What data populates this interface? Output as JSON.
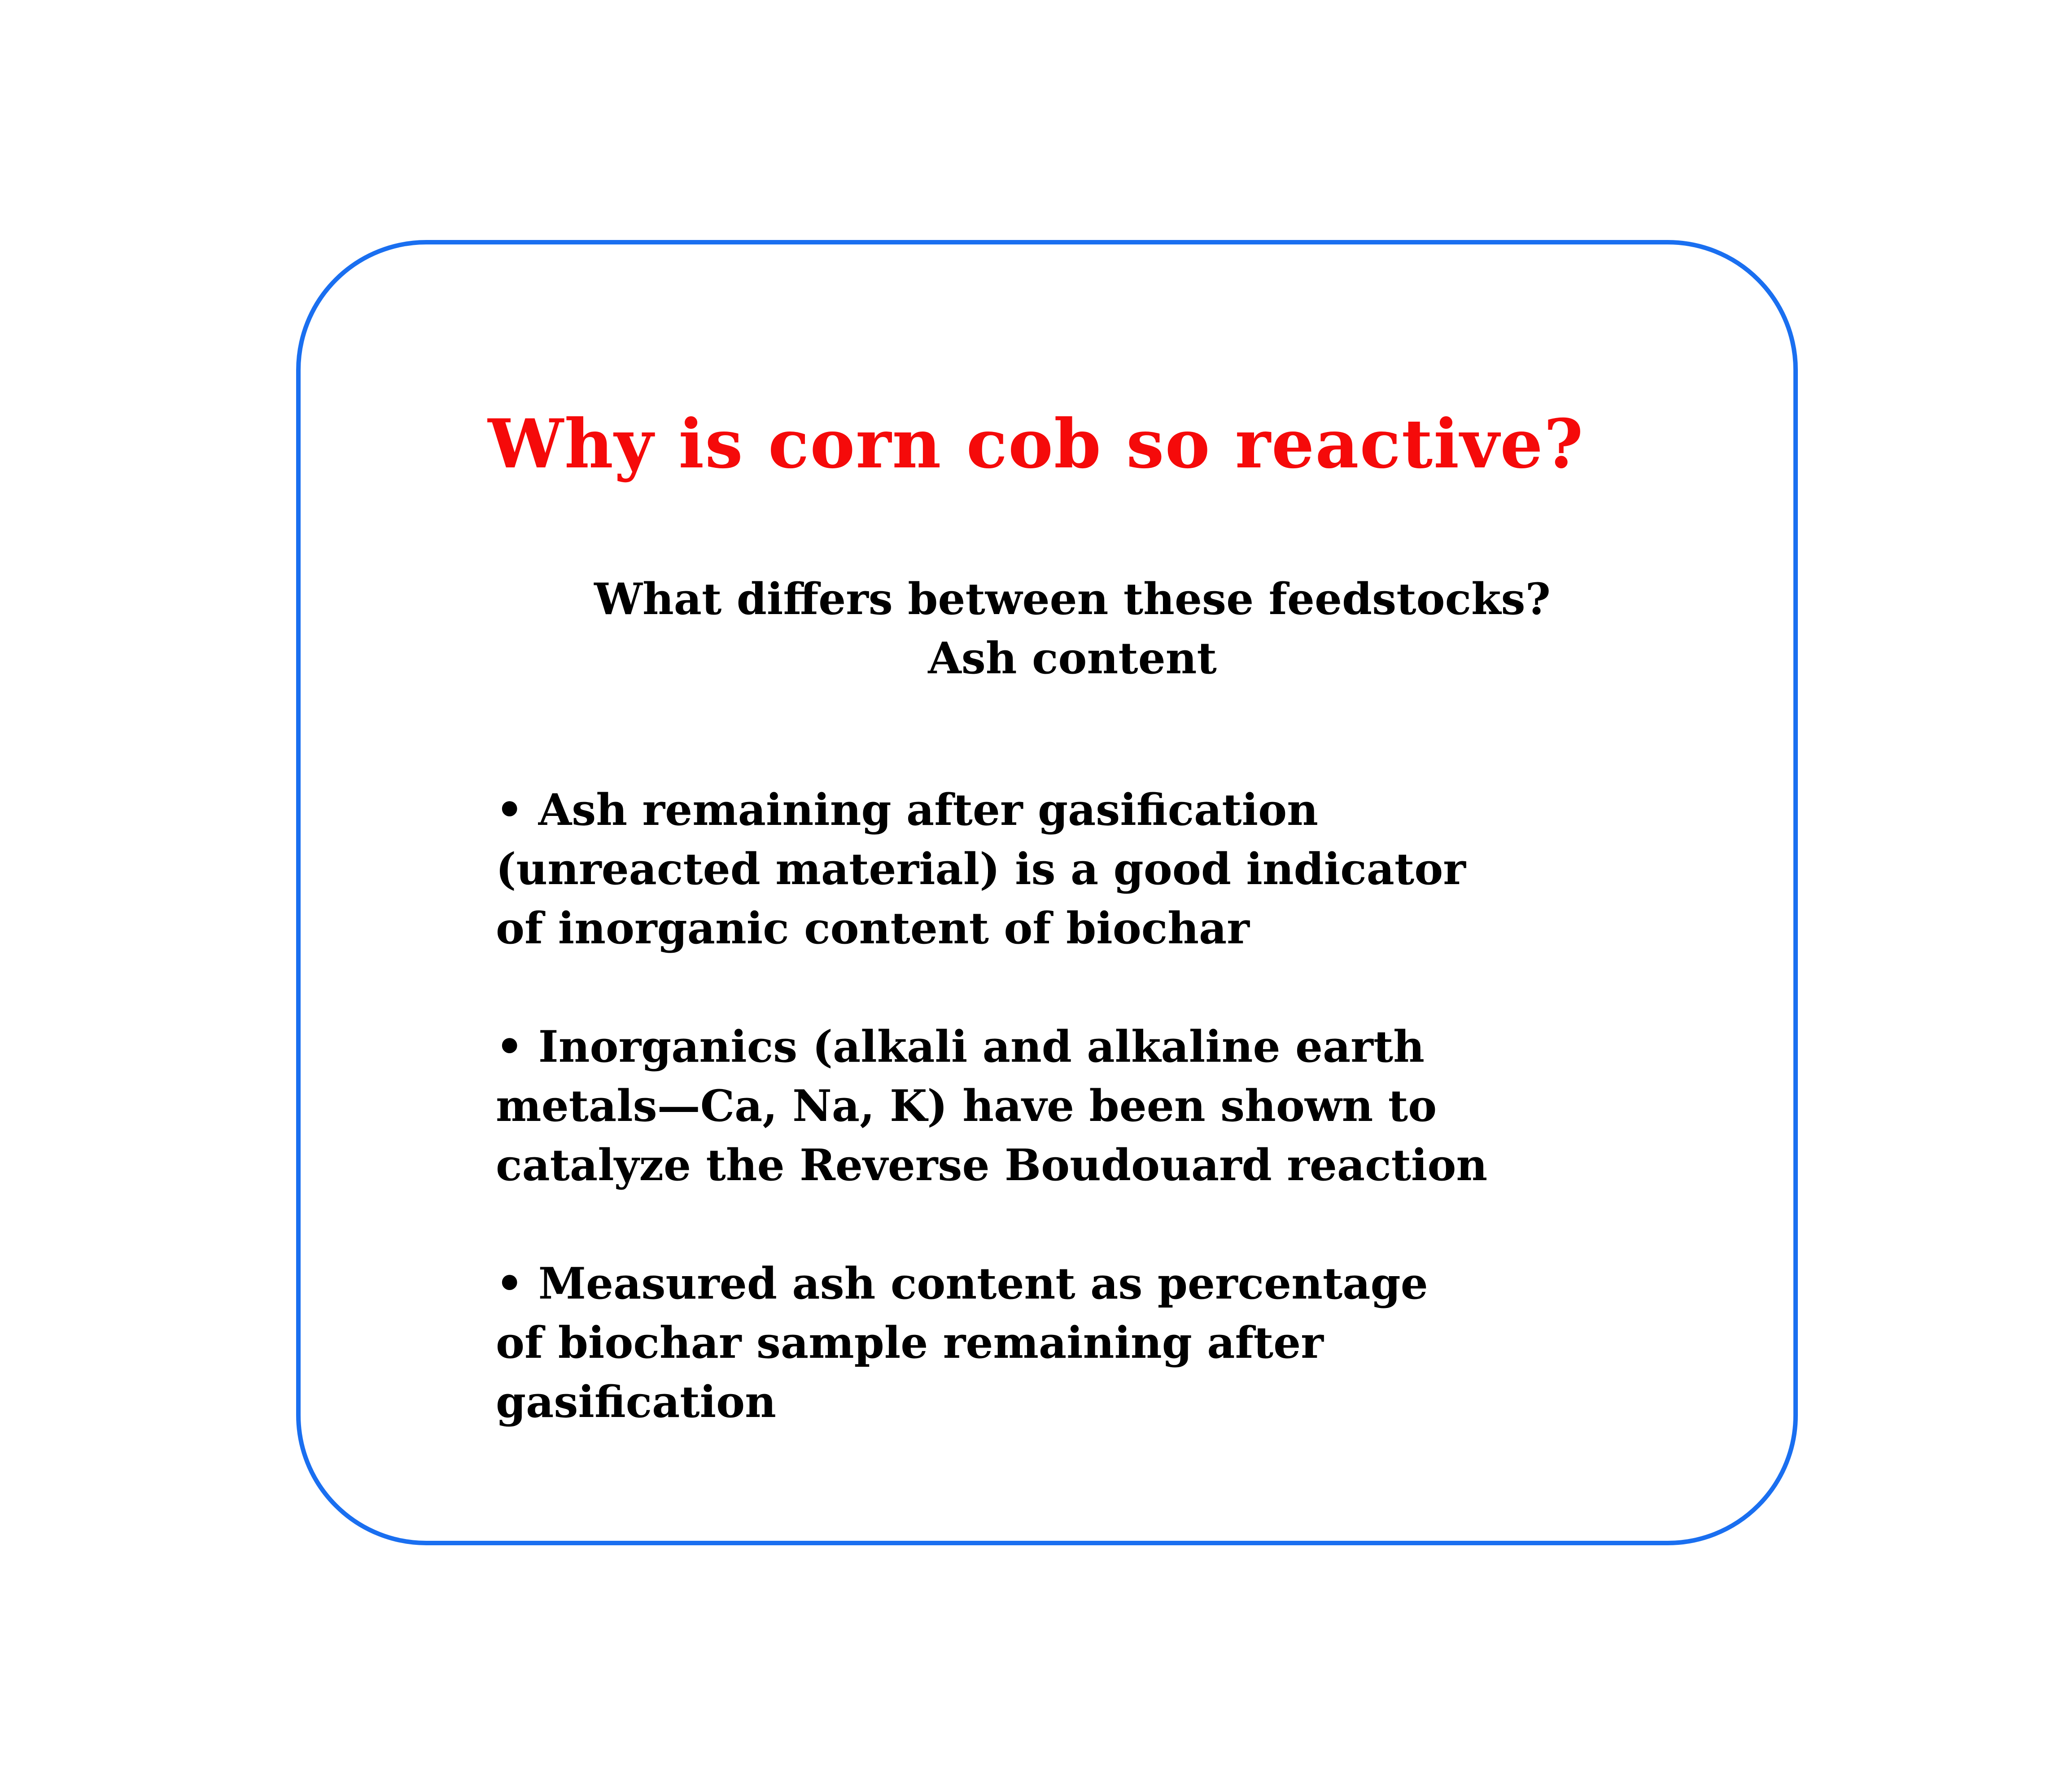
{
  "colors": {
    "border": "#1a6ff0",
    "title": "#f50a0a",
    "text": "#000000",
    "background": "#ffffff"
  },
  "title": "Why is corn cob so reactive?",
  "subtitle": {
    "line1": "What differs between these feedstocks?",
    "line2": "Ash content"
  },
  "bullets": [
    "• Ash remaining after gasification\n(unreacted material) is a good indicator\nof inorganic content of biochar",
    "• Inorganics (alkali and alkaline earth\nmetals—Ca, Na, K) have been shown to\ncatalyze the Reverse Boudouard reaction",
    "• Measured ash content as percentage\nof biochar sample remaining after\ngasification"
  ]
}
